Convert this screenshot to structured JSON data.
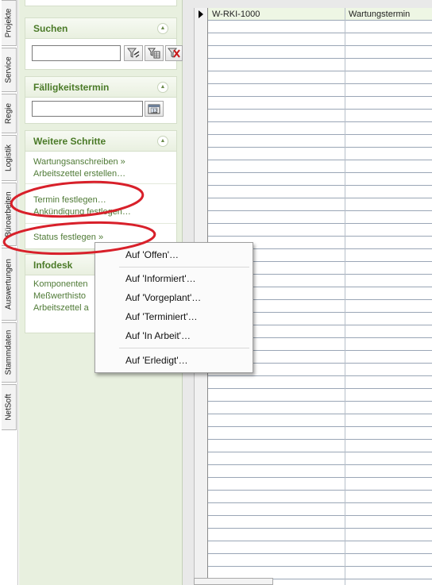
{
  "vertical_tabs": [
    "Projekte",
    "Service",
    "Regie",
    "Logistik",
    "Büroarbeiten",
    "Auswertungen",
    "Stammdaten",
    "NetSoft"
  ],
  "sidebar": {
    "suchen": {
      "title": "Suchen"
    },
    "faelligkeit": {
      "title": "Fälligkeitstermin"
    },
    "weitere": {
      "title": "Weitere Schritte",
      "links": [
        "Wartungsanschreiben »",
        "Arbeitszettel erstellen…",
        "Termin festlegen…",
        "Ankündigung festlegen…",
        "Status festlegen »"
      ]
    },
    "infodesk": {
      "title": "Infodesk",
      "links": [
        "Komponenten",
        "Meßwerthisto",
        "Arbeitszettel a"
      ]
    }
  },
  "grid": {
    "first_row": {
      "col_a": "W-RKI-1000",
      "col_b": "Wartungstermin"
    }
  },
  "context_menu": {
    "items": [
      "Auf 'Offen'…",
      "Auf 'Informiert'…",
      "Auf 'Vorgeplant'…",
      "Auf 'Terminiert'…",
      "Auf 'In Arbeit'…",
      "Auf 'Erledigt'…"
    ]
  },
  "colors": {
    "sidebar_bg": "#e8f0df",
    "panel_title": "#4a7a27",
    "link": "#4f7a36",
    "annotation": "#d8202a"
  }
}
